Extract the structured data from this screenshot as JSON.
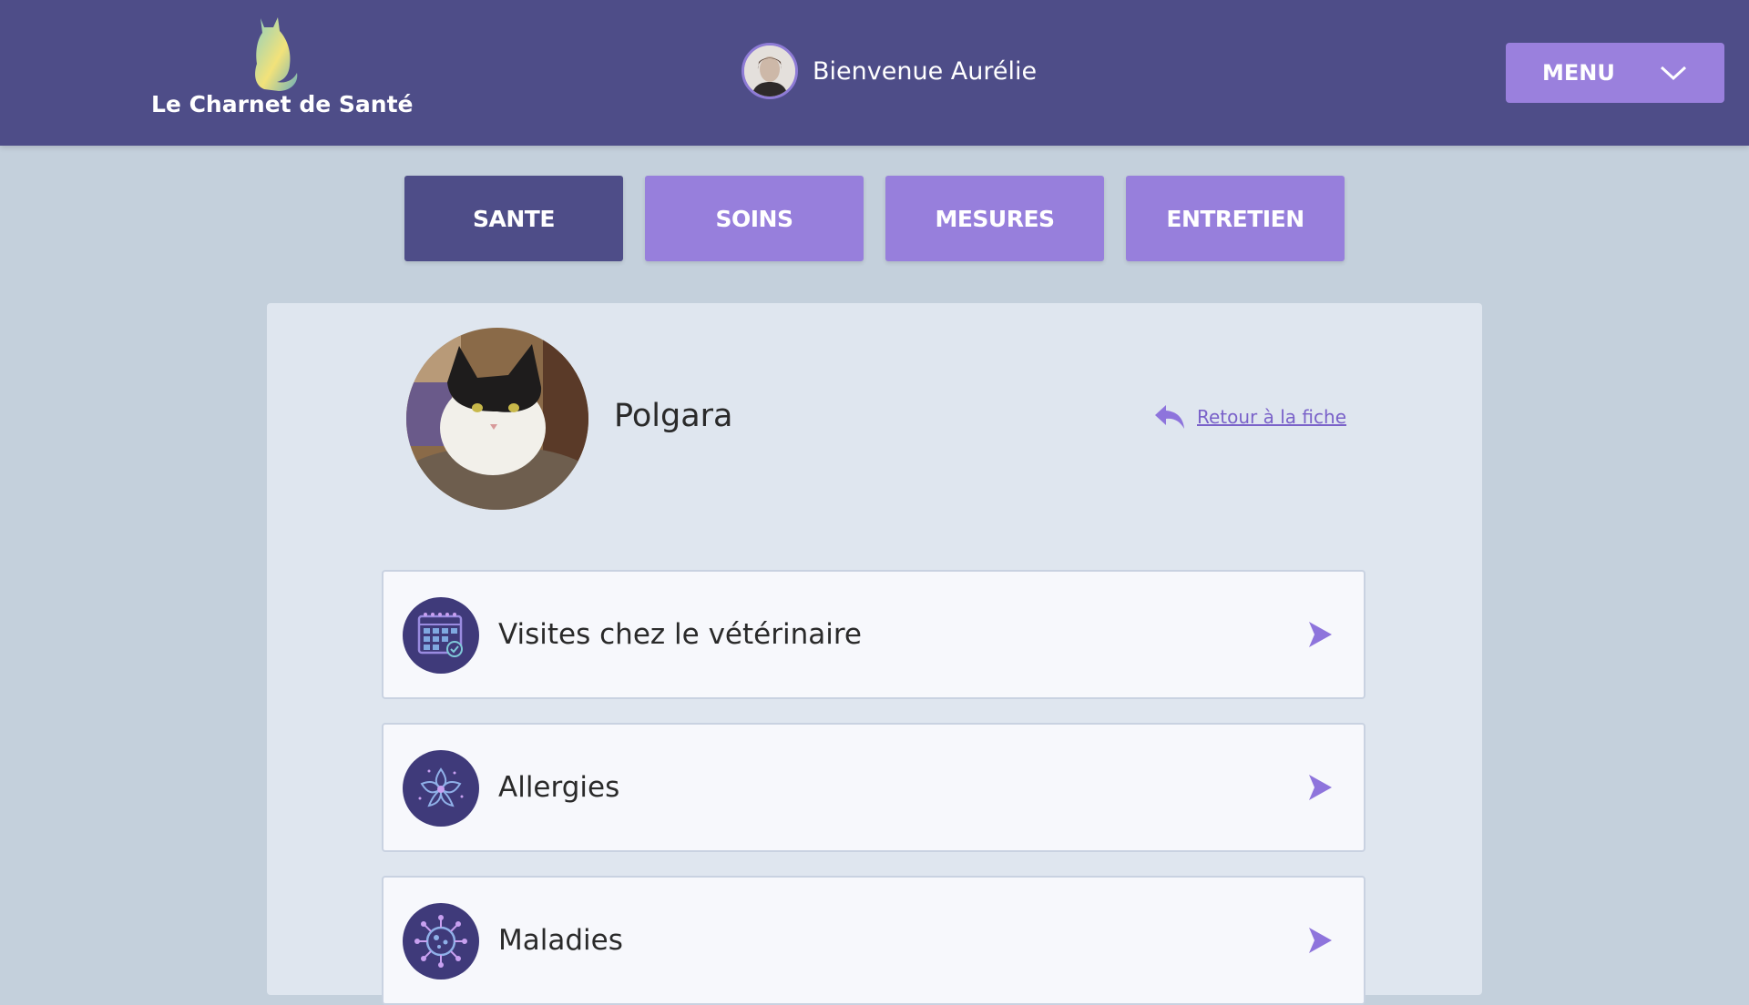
{
  "header": {
    "logo_text": "Le Charnet de Santé",
    "welcome_text": "Bienvenue Aurélie",
    "menu_label": "MENU"
  },
  "tabs": [
    {
      "label": "SANTE",
      "active": true
    },
    {
      "label": "SOINS",
      "active": false
    },
    {
      "label": "MESURES",
      "active": false
    },
    {
      "label": "ENTRETIEN",
      "active": false
    }
  ],
  "pet": {
    "name": "Polgara",
    "back_link": "Retour à la fiche"
  },
  "items": [
    {
      "label": "Visites chez le vétérinaire",
      "icon": "calendar-icon"
    },
    {
      "label": "Allergies",
      "icon": "flower-icon"
    },
    {
      "label": "Maladies",
      "icon": "virus-icon"
    }
  ],
  "colors": {
    "header_bg": "#4e4d88",
    "accent": "#977fdc",
    "active_tab": "#4e4d88",
    "page_bg": "#c4d0dc",
    "panel_bg": "#dfe6ef",
    "link": "#7a62c9"
  }
}
